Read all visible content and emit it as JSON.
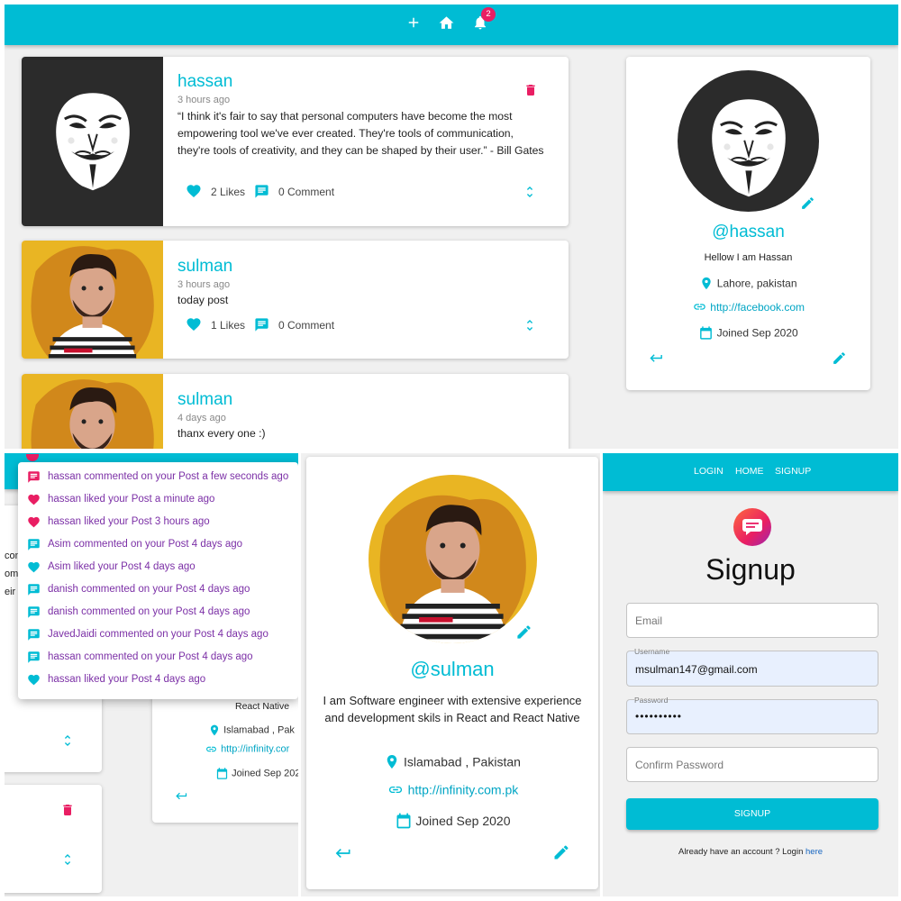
{
  "colors": {
    "accent": "#00bcd4",
    "danger": "#e91e63",
    "badge": "#e91e63",
    "page_bg": "#f0f0f0"
  },
  "top": {
    "navbar": {
      "icons": [
        "plus-icon",
        "home-icon",
        "bell-icon"
      ],
      "badge_count": "2"
    },
    "posts": [
      {
        "user": "hassan",
        "time": "3 hours ago",
        "body": "“I think it's fair to say that personal computers have become the most empowering tool we've ever created. They're tools of communication, they're tools of creativity, and they can be shaped by their user.” - Bill Gates",
        "likes": "2 Likes",
        "comments": "0 Comment"
      },
      {
        "user": "sulman",
        "time": "3 hours ago",
        "body": "today post",
        "likes": "1 Likes",
        "comments": "0 Comment"
      },
      {
        "user": "sulman",
        "time": "4 days ago",
        "body": "thanx every one :)"
      }
    ],
    "profile": {
      "handle": "@hassan",
      "bio": "Hellow I am Hassan",
      "location": "Lahore, pakistan",
      "website": "http://facebook.com",
      "joined": "Joined Sep 2020"
    }
  },
  "notifications": {
    "items": [
      {
        "icon": "comment-icon",
        "text": "hassan commented on your Post a few seconds ago"
      },
      {
        "icon": "heart-icon",
        "text": "hassan liked your Post a minute ago"
      },
      {
        "icon": "heart-icon",
        "text": "hassan liked your Post 3 hours ago"
      },
      {
        "icon": "comment-icon",
        "text": "Asim commented on your Post 4 days ago"
      },
      {
        "icon": "heart-icon",
        "text": "Asim liked your Post 4 days ago"
      },
      {
        "icon": "comment-icon",
        "text": "danish commented on your Post 4 days ago"
      },
      {
        "icon": "comment-icon",
        "text": "danish commented on your Post 4 days ago"
      },
      {
        "icon": "comment-icon",
        "text": "JavedJaidi commented on your Post 4 days ago"
      },
      {
        "icon": "comment-icon",
        "text": "hassan commented on your Post 4 days ago"
      },
      {
        "icon": "heart-icon",
        "text": "hassan liked your Post 4 days ago"
      }
    ],
    "behind": {
      "snippet_1": "com",
      "snippet_2": "omr",
      "snippet_3": "eir",
      "react_native": "React Native",
      "location": "Islamabad , Pak",
      "website": "http://infinity.cor",
      "joined": "Joined Sep 202"
    }
  },
  "sulman_profile": {
    "handle": "@sulman",
    "bio": "I am Software engineer with extensive experience and development skils in React and React Native",
    "location": "Islamabad , Pakistan",
    "website": "http://infinity.com.pk",
    "joined": "Joined Sep 2020"
  },
  "signup": {
    "nav": [
      "LOGIN",
      "HOME",
      "SIGNUP"
    ],
    "title": "Signup",
    "email_placeholder": "Email",
    "username_label": "Username",
    "username_value": "msulman147@gmail.com",
    "password_label": "Password",
    "password_value": "••••••••••",
    "confirm_placeholder": "Confirm Password",
    "button": "SIGNUP",
    "footer_text": "Already have an account ? Login ",
    "footer_link": "here"
  }
}
